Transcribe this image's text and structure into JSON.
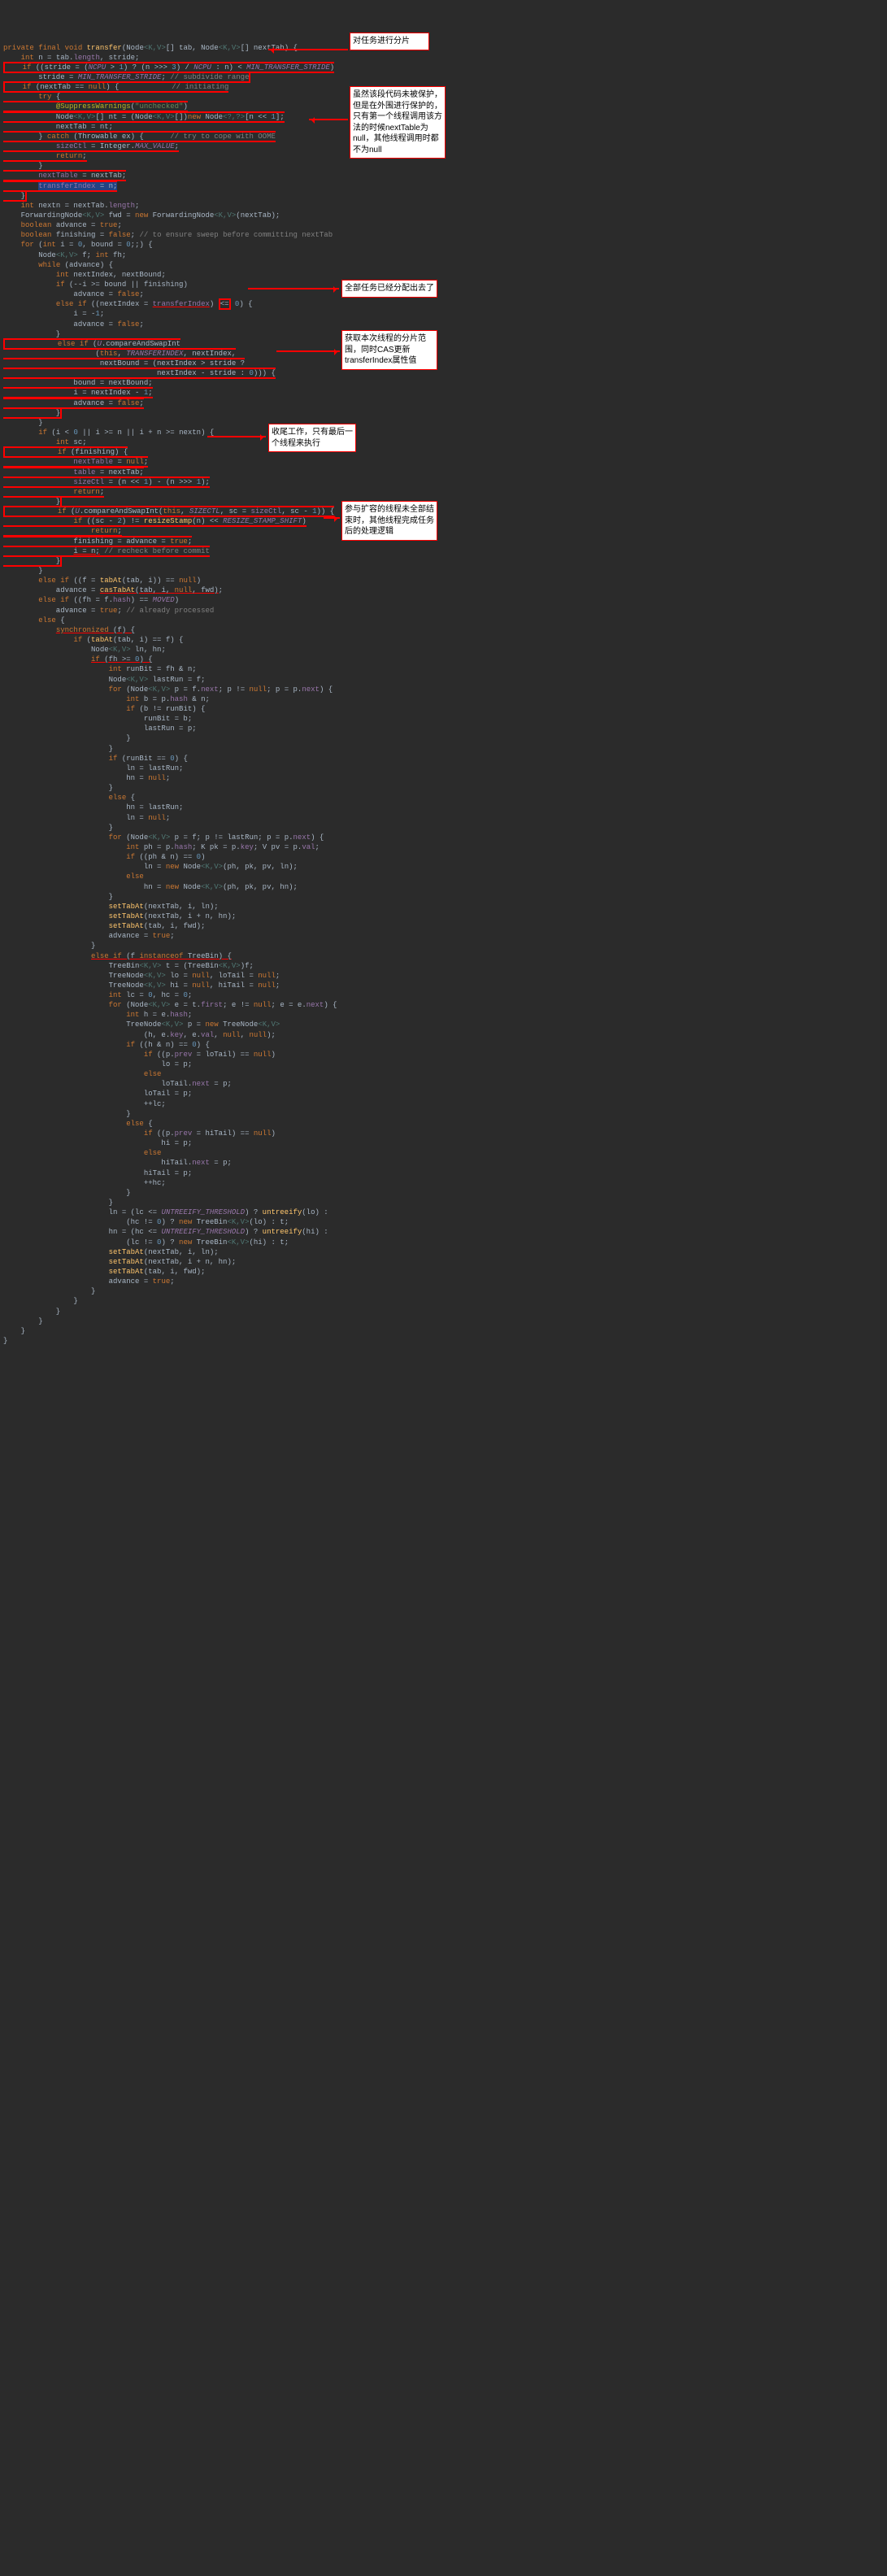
{
  "method_sig": "private final void transfer(Node<K,V>[] tab, Node<K,V>[] nextTab) {",
  "lines": [
    "    int n = tab.length, stride;",
    "    if ((stride = (NCPU > 1) ? (n >>> 3) / NCPU : n) < MIN_TRANSFER_STRIDE)",
    "        stride = MIN_TRANSFER_STRIDE; // subdivide range",
    "    if (nextTab == null) {            // initiating",
    "        try {",
    "            @SuppressWarnings(\"unchecked\")",
    "            Node<K,V>[] nt = (Node<K,V>[])new Node<?,?>[n << 1];",
    "            nextTab = nt;",
    "        } catch (Throwable ex) {      // try to cope with OOME",
    "            sizeCtl = Integer.MAX_VALUE;",
    "            return;",
    "        }",
    "        nextTable = nextTab;",
    "        transferIndex = n;",
    "    }",
    "    int nextn = nextTab.length;",
    "    ForwardingNode<K,V> fwd = new ForwardingNode<K,V>(nextTab);",
    "    boolean advance = true;",
    "    boolean finishing = false; // to ensure sweep before committing nextTab",
    "    for (int i = 0, bound = 0;;) {",
    "        Node<K,V> f; int fh;",
    "        while (advance) {",
    "            int nextIndex, nextBound;",
    "            if (--i >= bound || finishing)",
    "                advance = false;",
    "            else if ((nextIndex = transferIndex) <= 0) {",
    "                i = -1;",
    "                advance = false;",
    "            }",
    "            else if (U.compareAndSwapInt",
    "                     (this, TRANSFERINDEX, nextIndex,",
    "                      nextBound = (nextIndex > stride ?",
    "                                   nextIndex - stride : 0))) {",
    "                bound = nextBound;",
    "                i = nextIndex - 1;",
    "                advance = false;",
    "            }",
    "        }",
    "        if (i < 0 || i >= n || i + n >= nextn) {",
    "            int sc;",
    "            if (finishing) {",
    "                nextTable = null;",
    "                table = nextTab;",
    "                sizeCtl = (n << 1) - (n >>> 1);",
    "                return;",
    "            }",
    "            if (U.compareAndSwapInt(this, SIZECTL, sc = sizeCtl, sc - 1)) {",
    "                if ((sc - 2) != resizeStamp(n) << RESIZE_STAMP_SHIFT)",
    "                    return;",
    "                finishing = advance = true;",
    "                i = n; // recheck before commit",
    "            }",
    "        }",
    "        else if ((f = tabAt(tab, i)) == null)",
    "            advance = casTabAt(tab, i, null, fwd);",
    "        else if ((fh = f.hash) == MOVED)",
    "            advance = true; // already processed",
    "        else {",
    "            synchronized (f) {",
    "                if (tabAt(tab, i) == f) {",
    "                    Node<K,V> ln, hn;",
    "                    if (fh >= 0) {",
    "                        int runBit = fh & n;",
    "                        Node<K,V> lastRun = f;",
    "                        for (Node<K,V> p = f.next; p != null; p = p.next) {",
    "                            int b = p.hash & n;",
    "                            if (b != runBit) {",
    "                                runBit = b;",
    "                                lastRun = p;",
    "                            }",
    "                        }",
    "                        if (runBit == 0) {",
    "                            ln = lastRun;",
    "                            hn = null;",
    "                        }",
    "                        else {",
    "                            hn = lastRun;",
    "                            ln = null;",
    "                        }",
    "                        for (Node<K,V> p = f; p != lastRun; p = p.next) {",
    "                            int ph = p.hash; K pk = p.key; V pv = p.val;",
    "                            if ((ph & n) == 0)",
    "                                ln = new Node<K,V>(ph, pk, pv, ln);",
    "                            else",
    "                                hn = new Node<K,V>(ph, pk, pv, hn);",
    "                        }",
    "                        setTabAt(nextTab, i, ln);",
    "                        setTabAt(nextTab, i + n, hn);",
    "                        setTabAt(tab, i, fwd);",
    "                        advance = true;",
    "                    }",
    "                    else if (f instanceof TreeBin) {",
    "                        TreeBin<K,V> t = (TreeBin<K,V>)f;",
    "                        TreeNode<K,V> lo = null, loTail = null;",
    "                        TreeNode<K,V> hi = null, hiTail = null;",
    "                        int lc = 0, hc = 0;",
    "                        for (Node<K,V> e = t.first; e != null; e = e.next) {",
    "                            int h = e.hash;",
    "                            TreeNode<K,V> p = new TreeNode<K,V>",
    "                                (h, e.key, e.val, null, null);",
    "                            if ((h & n) == 0) {",
    "                                if ((p.prev = loTail) == null)",
    "                                    lo = p;",
    "                                else",
    "                                    loTail.next = p;",
    "                                loTail = p;",
    "                                ++lc;",
    "                            }",
    "                            else {",
    "                                if ((p.prev = hiTail) == null)",
    "                                    hi = p;",
    "                                else",
    "                                    hiTail.next = p;",
    "                                hiTail = p;",
    "                                ++hc;",
    "                            }",
    "                        }",
    "                        ln = (lc <= UNTREEIFY_THRESHOLD) ? untreeify(lo) :",
    "                            (hc != 0) ? new TreeBin<K,V>(lo) : t;",
    "                        hn = (hc <= UNTREEIFY_THRESHOLD) ? untreeify(hi) :",
    "                            (lc != 0) ? new TreeBin<K,V>(hi) : t;",
    "                        setTabAt(nextTab, i, ln);",
    "                        setTabAt(nextTab, i + n, hn);",
    "                        setTabAt(tab, i, fwd);",
    "                        advance = true;",
    "                    }",
    "                }",
    "            }",
    "        }",
    "    }",
    "}"
  ],
  "annot": {
    "a1": "对任务进行分片",
    "a2": "虽然该段代码未被保护，但是在外围进行保护的，只有第一个线程调用该方法的时候nextTable为null，其他线程调用时都不为null",
    "a3": "全部任务已经分配出去了",
    "a4": "获取本次线程的分片范围，同时CAS更新transferIndex属性值",
    "a5": "收尾工作，只有最后一个线程来执行",
    "a6": "参与扩容的线程未全部结束时，其他线程完成任务后的处理逻辑"
  }
}
